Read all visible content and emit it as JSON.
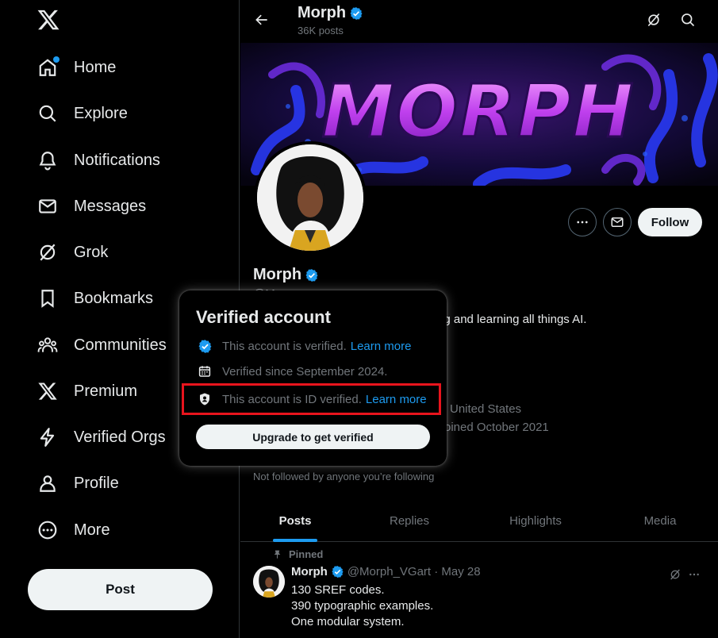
{
  "colors": {
    "accent": "#1d9bf0",
    "background": "#000000",
    "text": "#e7e9ea",
    "muted": "#71767b",
    "highlight": "#e8141d"
  },
  "nav": {
    "logo_icon": "x-logo-icon",
    "items": [
      {
        "label": "Home",
        "icon": "home-icon"
      },
      {
        "label": "Explore",
        "icon": "search-icon"
      },
      {
        "label": "Notifications",
        "icon": "bell-icon"
      },
      {
        "label": "Messages",
        "icon": "envelope-icon"
      },
      {
        "label": "Grok",
        "icon": "grok-icon"
      },
      {
        "label": "Bookmarks",
        "icon": "bookmark-icon"
      },
      {
        "label": "Communities",
        "icon": "communities-icon"
      },
      {
        "label": "Premium",
        "icon": "x-premium-icon"
      },
      {
        "label": "Verified Orgs",
        "icon": "lightning-icon"
      },
      {
        "label": "Profile",
        "icon": "person-icon"
      },
      {
        "label": "More",
        "icon": "more-circle-icon"
      }
    ],
    "post_label": "Post"
  },
  "header": {
    "title": "Morph",
    "posts_count": "36K posts"
  },
  "banner": {
    "text": "MORPH"
  },
  "profile": {
    "name": "Morph",
    "handle_partial": "@M...",
    "bio_visible": "ng and learning all things AI.",
    "location_visible": "United States",
    "joined_visible": "oined October 2021",
    "not_followed": "Not followed by anyone you’re following",
    "follow_label": "Follow"
  },
  "tabs": [
    {
      "label": "Posts",
      "active": true
    },
    {
      "label": "Replies",
      "active": false
    },
    {
      "label": "Highlights",
      "active": false
    },
    {
      "label": "Media",
      "active": false
    }
  ],
  "tweet": {
    "pinned_label": "Pinned",
    "name": "Morph",
    "handle": "@Morph_VGart",
    "date": "May 28",
    "meta": "@Morph_VGart · May 28",
    "lines": [
      "130 SREF codes.",
      "390 typographic examples.",
      "One modular system."
    ]
  },
  "popup": {
    "title": "Verified account",
    "rows": [
      {
        "text": "This account is verified.",
        "link": "Learn more",
        "icon": "verified-badge-icon"
      },
      {
        "text": "Verified since September 2024.",
        "link": "",
        "icon": "calendar-icon"
      },
      {
        "text": "This account is ID verified.",
        "link": "Learn more",
        "icon": "id-shield-icon"
      }
    ],
    "upgrade_label": "Upgrade to get verified"
  }
}
